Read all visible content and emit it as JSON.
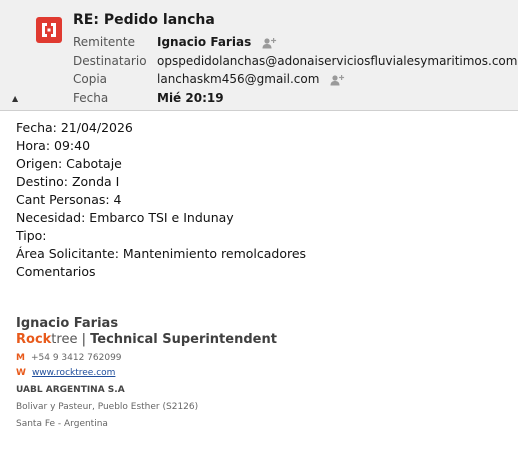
{
  "email": {
    "subject": "RE: Pedido lancha",
    "fields": {
      "from_label": "Remitente",
      "from_value": "Ignacio Farias",
      "to_label": "Destinatario",
      "to_value": "opspedidolanchas@adonaiserviciosfluvialesymaritimos.com",
      "cc_label": "Copia",
      "cc_value": "lanchaskm456@gmail.com",
      "date_label": "Fecha",
      "date_value": "Mié 20:19"
    }
  },
  "body": {
    "lines": [
      "Fecha: 21/04/2026",
      "Hora: 09:40",
      "Origen: Cabotaje",
      "Destino: Zonda I",
      "Cant Personas: 4",
      "Necesidad: Embarco TSI e Indunay",
      "Tipo:",
      "Área Solicitante: Mantenimiento remolcadores",
      "Comentarios"
    ]
  },
  "signature": {
    "name": "Ignacio Farias",
    "brand_rock": "Rock",
    "brand_tree": "tree",
    "separator": " | ",
    "title": "Technical Superintendent",
    "mobile_letter": "M",
    "mobile": "+54 9 3412 762099",
    "web_letter": "W",
    "web": "www.rocktree.com",
    "company": "UABL ARGENTINA S.A",
    "address": "Bolivar y Pasteur, Pueblo Esther (S2126)",
    "city": "Santa Fe - Argentina"
  },
  "icons": {
    "logo": "app-logo-icon",
    "add_contact": "add-contact-icon",
    "collapse": "collapse-arrow-icon"
  },
  "colors": {
    "logo_red": "#e03a30",
    "brand_orange": "#e85a1b",
    "link_blue": "#1f4e9c"
  }
}
